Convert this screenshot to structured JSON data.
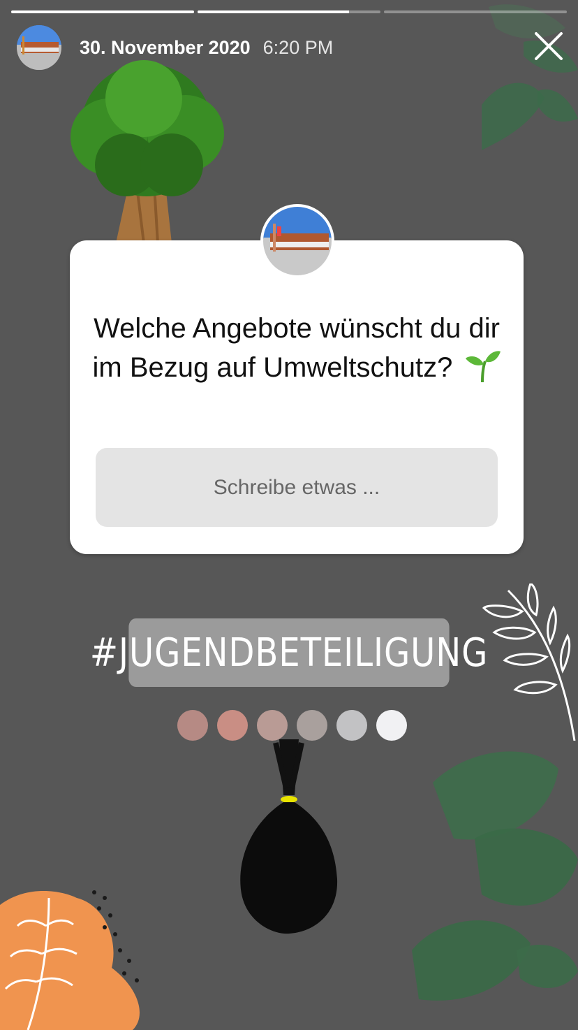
{
  "header": {
    "date": "30. November 2020",
    "time": "6:20 PM"
  },
  "progress": [
    1.0,
    0.83,
    0.0
  ],
  "question_sticker": {
    "question": "Welche Angebote wünscht du dir im Bezug auf Umweltschutz?",
    "emoji": "seedling-icon",
    "placeholder": "Schreibe etwas ..."
  },
  "hashtag": "#JUGENDBETEILIGUNG",
  "color_dots": [
    "#b68a84",
    "#c98e84",
    "#b99b95",
    "#a9a09d",
    "#c2c2c4",
    "#f1f1f3"
  ],
  "colors": {
    "background": "#575757",
    "card": "#ffffff",
    "answer_field": "#e4e4e4",
    "hashtag_bg": "#9b9b9b"
  }
}
